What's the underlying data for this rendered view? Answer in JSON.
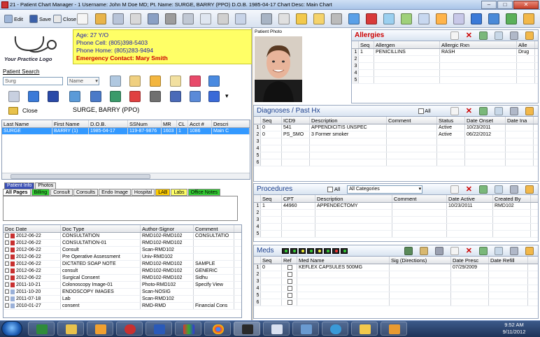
{
  "window": {
    "title": "21 - Patient Chart Manager - 1  Username: John M  Doe  MD; Pt. Name: SURGE, BARRY (PPO)  D.O.B. 1985-04-17  Chart Desc: Main Chart"
  },
  "toolbar": {
    "edit": "Edit",
    "save": "Save",
    "close": "Close"
  },
  "patient": {
    "age": "Age: 27 Y/O",
    "cell": "Phone Cell: (805)398-5403",
    "home": "Phone Home: (805)283-9494",
    "emergency": "Emergency Contact: Mary Smith",
    "logo_text": "Your Practice Logo",
    "name_display": "SURGE, BARRY (PPO)"
  },
  "search": {
    "label": "Patient Search",
    "value": "Surg",
    "field": "Name",
    "close_label": "Close"
  },
  "patient_list": {
    "headers": [
      "Last Name",
      "First Name",
      "D.O.B.",
      "SSNum",
      "MR",
      "CL",
      "Acct #",
      "Descri"
    ],
    "rows": [
      [
        "SURGE",
        "BARRY (1)",
        "1985-04-17",
        "119-87-9876",
        "1603",
        "1",
        "1086",
        "Main C"
      ]
    ]
  },
  "tabs_top": [
    "Patient Info",
    "Photos"
  ],
  "tabs2": [
    "All Pages",
    "Billing",
    "Consult",
    "Consults",
    "Endo Image",
    "Hospital",
    "LAB",
    "Labs",
    "Office Notes"
  ],
  "documents": {
    "headers": [
      "Doc Date",
      "Doc Type",
      "Author-Signor",
      "Comment"
    ],
    "rows": [
      [
        "2012-06-22",
        "CONSULTATION",
        "RMD102-RMD102",
        "CONSULTATIO"
      ],
      [
        "2012-06-22",
        "CONSULTATION-01",
        "RMD102-RMD102",
        ""
      ],
      [
        "2012-06-22",
        "Consult",
        "Scan-RMD102",
        ""
      ],
      [
        "2012-06-22",
        "Pre Operative Assessment",
        "Univ-RMD102",
        ""
      ],
      [
        "2012-06-22",
        "DICTATED SOAP NOTE",
        "RMD102-RMD102",
        "SAMPLE"
      ],
      [
        "2012-06-22",
        "consult",
        "RMD102-RMD102",
        "GENERIC"
      ],
      [
        "2012-06-22",
        "Surgical Consent",
        "RMD102-RMD102",
        "Sidhu"
      ],
      [
        "2011-10-21",
        "Colonoscopy Image-01",
        "Photo-RMD102",
        "Specify View"
      ],
      [
        "2011-10-20",
        "ENDOSCOPY IMAGES",
        "Scan-NOSIG",
        ""
      ],
      [
        "2011-07-18",
        "Lab",
        "Scan-RMD102",
        ""
      ],
      [
        "2010-01-27",
        "consent",
        "RMD-RMD",
        "Financial Cons"
      ]
    ]
  },
  "photo": {
    "label": "Patient Photo"
  },
  "allergies": {
    "title": "Allergies",
    "headers": [
      "Seq",
      "Allergen",
      "Allergic Rxn",
      "Alle"
    ],
    "rows": [
      [
        "1",
        "PENICILLINS",
        "RASH",
        "Drug"
      ]
    ],
    "row_numbers": [
      "1",
      "2",
      "3",
      "4",
      "5"
    ]
  },
  "diagnoses": {
    "title": "Diagnoses / Past Hx",
    "all_label": "All",
    "headers": [
      "Seq",
      "ICD9",
      "Description",
      "Comment",
      "Status",
      "Date Onset",
      "Date Ina"
    ],
    "rows": [
      [
        "0",
        "541",
        "APPENDICITIS UNSPEC",
        "",
        "Active",
        "10/23/2011",
        ""
      ],
      [
        "0",
        "PS_SMO",
        "3 Former smoker",
        "",
        "Active",
        "06/22/2012",
        ""
      ]
    ],
    "row_numbers": [
      "1",
      "2",
      "3",
      "4",
      "5",
      "6"
    ]
  },
  "procedures": {
    "title": "Procedures",
    "all_label": "All",
    "category": "All Categories",
    "headers": [
      "Seq",
      "CPT",
      "Description",
      "Comment",
      "Date Active",
      "Created By"
    ],
    "rows": [
      [
        "1",
        "44960",
        "APPENDECTOMY",
        "",
        "10/23/2011",
        "RMD102"
      ]
    ],
    "row_numbers": [
      "1",
      "2",
      "3",
      "4",
      "5"
    ]
  },
  "meds": {
    "title": "Meds",
    "headers": [
      "Seq",
      "Ref",
      "Med Name",
      "Sig (Directions)",
      "Date Presc",
      "Date Refill"
    ],
    "rows": [
      [
        "0",
        "",
        "KEFLEX CAPSULES 500MG",
        "",
        "07/29/2009",
        ""
      ]
    ],
    "row_numbers": [
      "1",
      "2",
      "3",
      "4",
      "5",
      "6"
    ]
  },
  "clock": {
    "time": "9:52 AM",
    "date": "9/11/2012"
  },
  "colors": {
    "accent": "#3399ff",
    "info_bg": "#ffff66",
    "alert_red": "#cc0000"
  }
}
